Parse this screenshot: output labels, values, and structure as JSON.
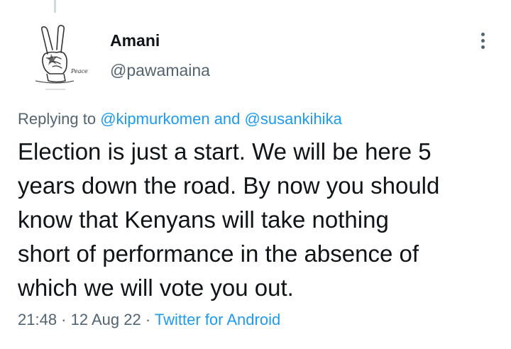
{
  "author": {
    "name": "Amani",
    "handle": "@pawamaina",
    "avatar_caption": "Peace"
  },
  "reply": {
    "prefix": "Replying to ",
    "mention_1": "@kipmurkomen",
    "conjunction": " and ",
    "mention_2": "@susankihika"
  },
  "tweet": {
    "lines": [
      "Election is just a start. We will be here 5",
      "years down the road. By now you should",
      "know that Kenyans will take nothing",
      "short of performance in the absence of",
      "which we will vote you out."
    ]
  },
  "meta": {
    "time": "21:48",
    "separator": " · ",
    "date": "12 Aug 22",
    "source": "Twitter for Android"
  },
  "icons": {
    "more": "more-options-icon",
    "avatar": "peace-hand-sketch"
  },
  "colors": {
    "text": "#0f1419",
    "secondary": "#536471",
    "link": "#1d9bf0"
  }
}
